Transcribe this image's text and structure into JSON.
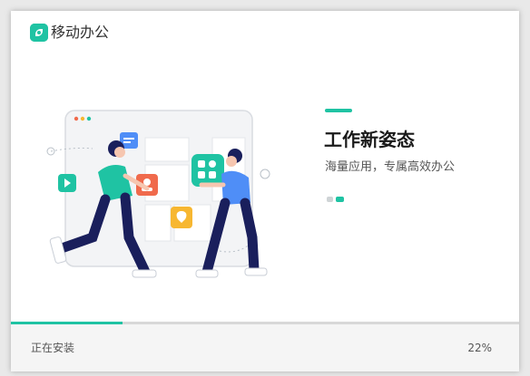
{
  "app": {
    "title": "移动办公",
    "logo_icon": "mobile-office-logo-icon",
    "accent_color": "#1fc3a3"
  },
  "slide": {
    "headline": "工作新姿态",
    "subline": "海量应用，专属高效办公",
    "illustration_icon": "team-collaboration-illustration",
    "carousel_count": 2,
    "carousel_active_index": 1
  },
  "install": {
    "status": "正在安装",
    "percent_label": "22%",
    "progress": 0.22
  }
}
